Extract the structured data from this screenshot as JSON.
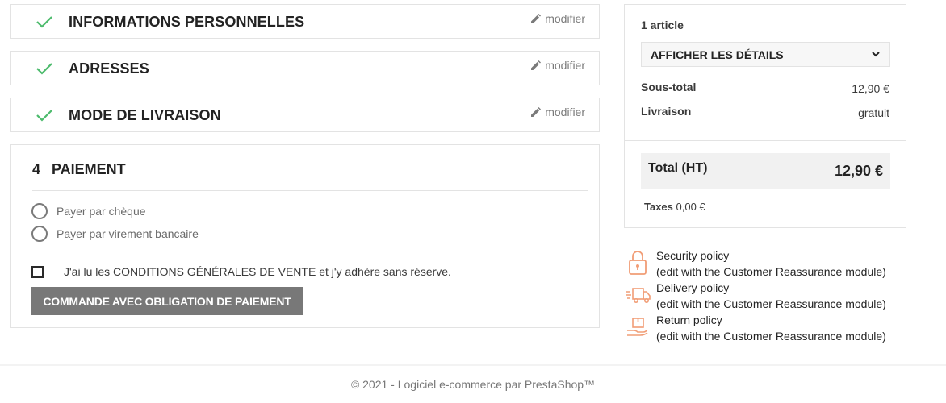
{
  "steps": [
    {
      "title": "INFORMATIONS PERSONNELLES",
      "edit": "modifier"
    },
    {
      "title": "ADRESSES",
      "edit": "modifier"
    },
    {
      "title": "MODE DE LIVRAISON",
      "edit": "modifier"
    }
  ],
  "payment": {
    "number": "4",
    "title": "PAIEMENT",
    "options": [
      "Payer par chèque",
      "Payer par virement bancaire"
    ],
    "terms": "J'ai lu les CONDITIONS GÉNÉRALES DE VENTE et j'y adhère sans réserve.",
    "order_button": "COMMANDE AVEC OBLIGATION DE PAIEMENT"
  },
  "summary": {
    "count": "1 article",
    "details_button": "AFFICHER LES DÉTAILS",
    "subtotal_label": "Sous-total",
    "subtotal_value": "12,90 €",
    "shipping_label": "Livraison",
    "shipping_value": "gratuit",
    "total_label": "Total (HT)",
    "total_value": "12,90 €",
    "taxes_label": "Taxes",
    "taxes_value": "0,00 €"
  },
  "reassurance": [
    {
      "title": "Security policy",
      "subtitle": "(edit with the Customer Reassurance module)",
      "icon": "lock-icon"
    },
    {
      "title": "Delivery policy",
      "subtitle": "(edit with the Customer Reassurance module)",
      "icon": "delivery-truck-icon"
    },
    {
      "title": "Return policy",
      "subtitle": "(edit with the Customer Reassurance module)",
      "icon": "return-package-icon"
    }
  ],
  "footer": "© 2021 - Logiciel e-commerce par PrestaShop™",
  "colors": {
    "check": "#4cbb6c",
    "accent_icon": "#f19d76",
    "button": "#787878"
  }
}
